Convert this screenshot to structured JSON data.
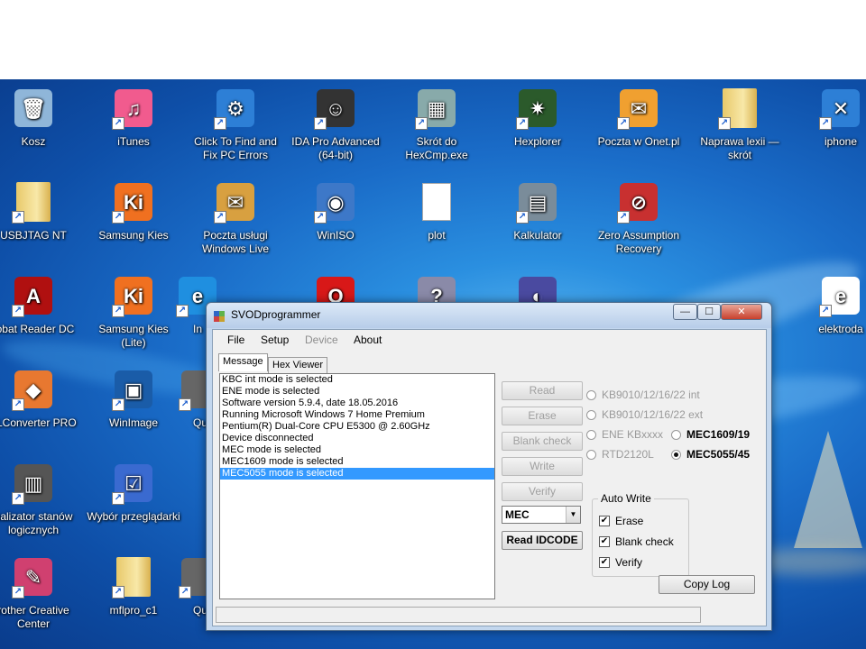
{
  "desktop": {
    "icons": [
      {
        "label": "Kosz",
        "icon": "recycle-bin-icon",
        "glyph": "🗑"
      },
      {
        "label": "iTunes",
        "icon": "itunes-icon",
        "glyph": "♫"
      },
      {
        "label": "Click To Find and Fix PC Errors",
        "icon": "pc-fix-icon",
        "glyph": "⚙"
      },
      {
        "label": "IDA Pro Advanced (64-bit)",
        "icon": "ida-pro-icon",
        "glyph": "☺"
      },
      {
        "label": "Skrót do HexCmp.exe",
        "icon": "hexcmp-icon",
        "glyph": "▦"
      },
      {
        "label": "Hexplorer",
        "icon": "hexplorer-icon",
        "glyph": "✷"
      },
      {
        "label": "Poczta w Onet.pl",
        "icon": "onet-mail-icon",
        "glyph": "✉"
      },
      {
        "label": "Naprawa lexii — skrót",
        "icon": "folder-icon",
        "glyph": ""
      },
      {
        "label": "iphone",
        "icon": "iphone-icon",
        "glyph": "✕"
      },
      {
        "label": "USBJTAG NT",
        "icon": "folder-icon",
        "glyph": ""
      },
      {
        "label": "Samsung Kies",
        "icon": "samsung-kies-icon",
        "glyph": "Ki"
      },
      {
        "label": "Poczta usługi Windows Live",
        "icon": "windows-live-mail-icon",
        "glyph": "✉"
      },
      {
        "label": "WinISO",
        "icon": "winiso-icon",
        "glyph": "◉"
      },
      {
        "label": "plot",
        "icon": "text-file-icon",
        "glyph": ""
      },
      {
        "label": "Kalkulator",
        "icon": "calculator-icon",
        "glyph": "▤"
      },
      {
        "label": "Zero Assumption Recovery",
        "icon": "zar-recovery-icon",
        "glyph": "⊘"
      },
      {
        "label": "robat Reader DC",
        "icon": "acrobat-reader-icon",
        "glyph": "A"
      },
      {
        "label": "Samsung Kies (Lite)",
        "icon": "samsung-kies-lite-icon",
        "glyph": "Ki"
      },
      {
        "label": "In",
        "icon": "internet-explorer-icon",
        "glyph": "e"
      },
      {
        "label": "",
        "icon": "opera-icon",
        "glyph": "O"
      },
      {
        "label": "",
        "icon": "help-file-icon",
        "glyph": "?"
      },
      {
        "label": "",
        "icon": "app-icon",
        "glyph": "◐"
      },
      {
        "label": "elektroda",
        "icon": "ie-shortcut-icon",
        "glyph": "e"
      },
      {
        "label": "LLConverter PRO",
        "icon": "converter-icon",
        "glyph": "◆"
      },
      {
        "label": "WinImage",
        "icon": "winimage-icon",
        "glyph": "▣"
      },
      {
        "label": "Qu",
        "icon": "app-icon-2",
        "glyph": ""
      },
      {
        "label": "nalizator stanów logicznych",
        "icon": "logic-analyzer-icon",
        "glyph": "▥"
      },
      {
        "label": "Wybór przeglądarki",
        "icon": "browser-choice-icon",
        "glyph": "☑"
      },
      {
        "label": "rother Creative Center",
        "icon": "brother-creative-icon",
        "glyph": "✎"
      },
      {
        "label": "mflpro_c1",
        "icon": "folder-icon",
        "glyph": ""
      },
      {
        "label": "Qu",
        "icon": "app-icon-3",
        "glyph": ""
      }
    ]
  },
  "window": {
    "title": "SVODprogrammer",
    "caption_buttons": {
      "minimize": "—",
      "maximize": "☐",
      "close": "✕"
    },
    "menu": [
      {
        "label": "File",
        "enabled": true
      },
      {
        "label": "Setup",
        "enabled": true
      },
      {
        "label": "Device",
        "enabled": false
      },
      {
        "label": "About",
        "enabled": true
      }
    ],
    "tabs": [
      {
        "label": "Message",
        "active": true
      },
      {
        "label": "Hex Viewer",
        "active": false
      }
    ],
    "log": [
      "KBC int mode is selected",
      "ENE mode is selected",
      "Software version 5.9.4, date 18.05.2016",
      "Running Microsoft Windows 7 Home Premium",
      "Pentium(R) Dual-Core  CPU      E5300  @ 2.60GHz",
      "Device disconnected",
      "MEC mode is selected",
      "MEC1609 mode is selected",
      "MEC5055 mode is selected"
    ],
    "log_selected_index": 8,
    "buttons": {
      "read": "Read",
      "erase": "Erase",
      "blank_check": "Blank check",
      "write": "Write",
      "verify": "Verify",
      "read_idcode": "Read IDCODE",
      "copy_log": "Copy Log"
    },
    "chip_combo": "MEC",
    "radios": {
      "kb9010_int": "KB9010/12/16/22 int",
      "kb9010_ext": "KB9010/12/16/22 ext",
      "ene_kbxxxx": "ENE KBxxxx",
      "mec1609": "MEC1609/19",
      "rtd2120l": "RTD2120L",
      "mec5055": "MEC5055/45"
    },
    "auto_write": {
      "label": "Auto Write",
      "erase": "Erase",
      "blank_check": "Blank check",
      "verify": "Verify"
    }
  }
}
